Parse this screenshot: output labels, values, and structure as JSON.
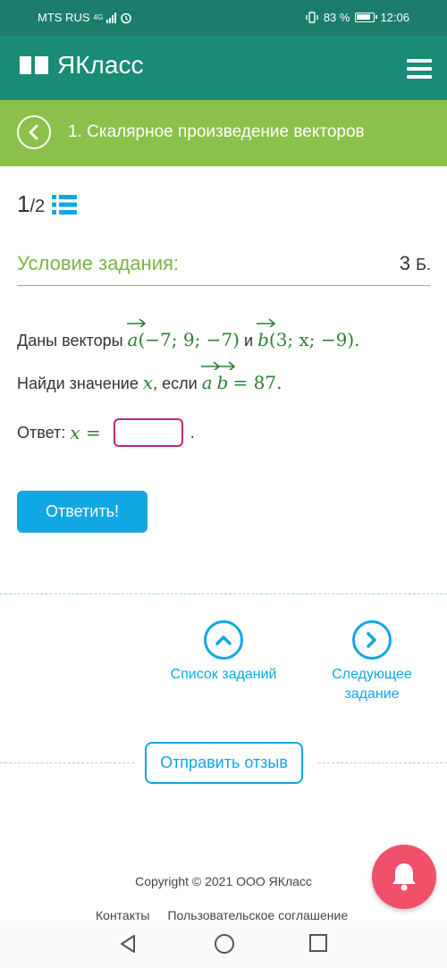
{
  "status_bar": {
    "carrier": "MTS RUS",
    "network": "4G",
    "battery": "83 %",
    "time": "12:06"
  },
  "header": {
    "logo_text": "ЯКласс",
    "menu_icon": "hamburger-icon"
  },
  "topic": {
    "title": "1. Скалярное произведение векторов"
  },
  "progress": {
    "current": "1",
    "total": "/2"
  },
  "task": {
    "condition_title": "Условие задания:",
    "points": "3",
    "points_unit": "Б.",
    "line1_prefix": "Даны векторы",
    "vec_a": "a",
    "vec_a_coords": "(−7; 9; −7)",
    "conj": "и",
    "vec_b": "b",
    "vec_b_coords": "(3; x; −9).",
    "line2_prefix": "Найди значение",
    "var_x": "x",
    "line2_if": ", если",
    "product_value": "= 87.",
    "answer_label": "Ответ:",
    "answer_var": "x =",
    "answer_value": "",
    "answer_suffix": "."
  },
  "buttons": {
    "submit": "Ответить!",
    "task_list": "Список заданий",
    "next_task_line1": "Следующее",
    "next_task_line2": "задание",
    "feedback": "Отправить отзыв"
  },
  "footer": {
    "copyright": "Copyright © 2021 ООО ЯКласс",
    "contacts": "Контакты",
    "agreement": "Пользовательское соглашение"
  },
  "colors": {
    "header": "#1a8c75",
    "topic_bar": "#8bc14b",
    "accent_blue": "#10a7e2",
    "math_green": "#2e7d32",
    "input_border": "#c0267a",
    "bell": "#f0506a"
  }
}
